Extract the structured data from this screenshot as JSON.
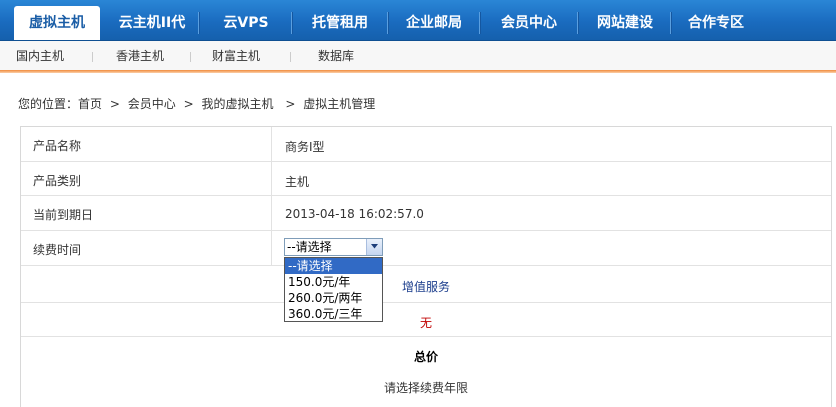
{
  "topnav": {
    "tabs": [
      "虚拟主机",
      "云主机II代",
      "云VPS",
      "托管租用",
      "企业邮局",
      "会员中心",
      "网站建设",
      "合作专区"
    ]
  },
  "subnav": {
    "items": [
      "国内主机",
      "香港主机",
      "财富主机",
      "数据库"
    ]
  },
  "breadcrumb": {
    "prefix": "您的位置：",
    "home": "首页",
    "sep": ">",
    "member": "会员中心",
    "vhost": "我的虚拟主机",
    "current": "虚拟主机管理"
  },
  "details": {
    "product_name_label": "产品名称",
    "product_name": "商务I型",
    "category_label": "产品类别",
    "category": "主机",
    "expiry_label": "当前到期日",
    "expiry": "2013-04-18 16:02:57.0",
    "renew_label": "续费时间"
  },
  "renew_select": {
    "selected": "--请选择",
    "options": [
      "--请选择",
      "150.0元/年",
      "260.0元/两年",
      "360.0元/三年"
    ]
  },
  "value_added": {
    "title": "增值服务",
    "value": "无"
  },
  "total": {
    "title": "总价",
    "hint": "请选择续费年限"
  }
}
